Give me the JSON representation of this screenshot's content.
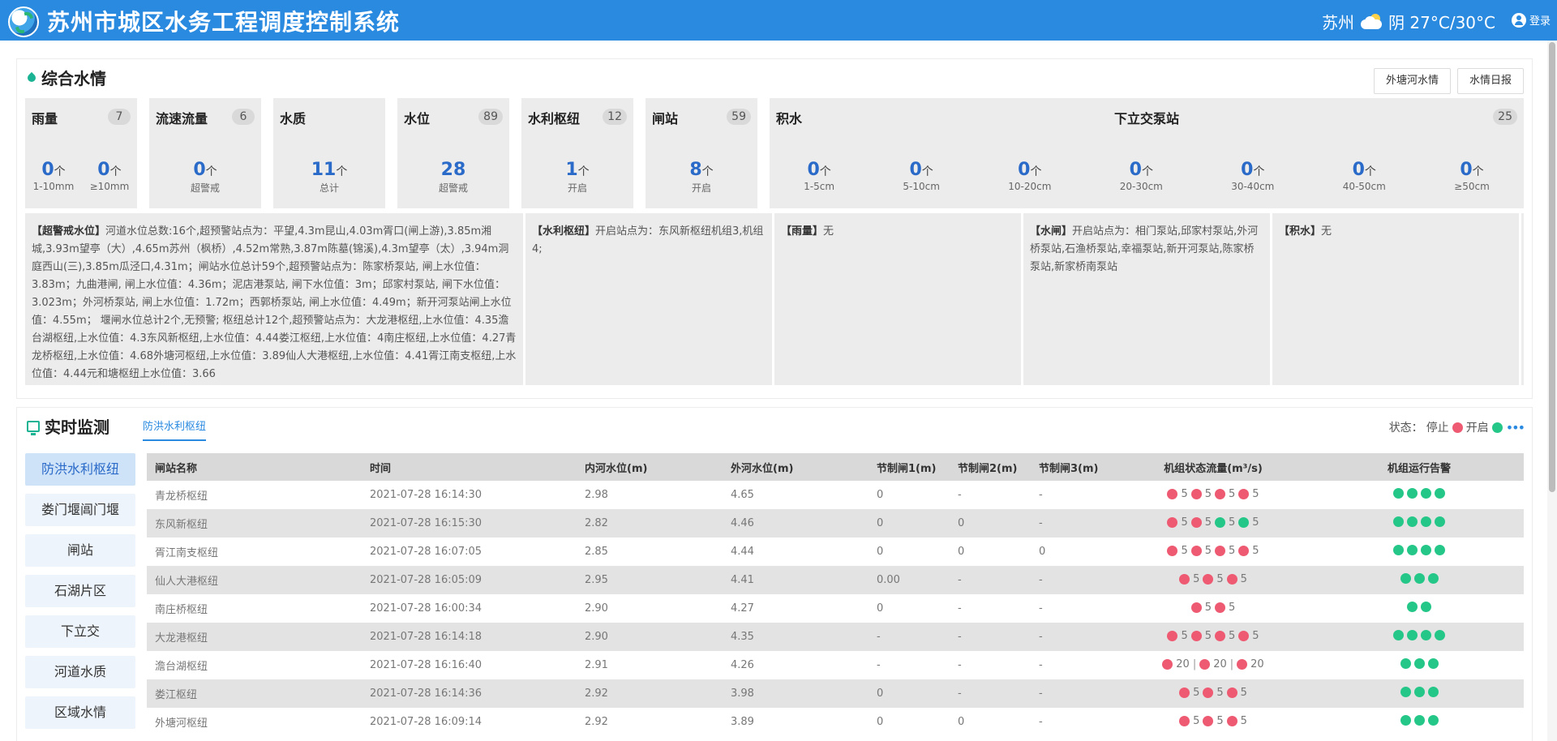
{
  "header": {
    "title": "苏州市城区水务工程调度控制系统",
    "city": "苏州",
    "weather_text": "阴 27°C/30°C",
    "login_label": "登录"
  },
  "overview": {
    "title": "综合水情",
    "buttons": [
      "外塘河水情",
      "水情日报"
    ],
    "cards": [
      {
        "label": "雨量",
        "count": "7",
        "metrics": [
          {
            "value": "0",
            "unit": "个",
            "caption": "1-10mm"
          },
          {
            "value": "0",
            "unit": "个",
            "caption": "≥10mm"
          }
        ]
      },
      {
        "label": "流速流量",
        "count": "6",
        "metrics": [
          {
            "value": "0",
            "unit": "个",
            "caption": "超警戒"
          }
        ]
      },
      {
        "label": "水质",
        "count": "",
        "metrics": [
          {
            "value": "11",
            "unit": "个",
            "caption": "总计"
          }
        ]
      },
      {
        "label": "水位",
        "count": "89",
        "metrics": [
          {
            "value": "28",
            "unit": "",
            "caption": "超警戒"
          }
        ]
      },
      {
        "label": "水利枢纽",
        "count": "12",
        "metrics": [
          {
            "value": "1",
            "unit": "个",
            "caption": "开启"
          }
        ]
      },
      {
        "label": "闸站",
        "count": "59",
        "metrics": [
          {
            "value": "8",
            "unit": "个",
            "caption": "开启"
          }
        ]
      }
    ],
    "wide_card": {
      "label": "积水",
      "sublabel": "下立交泵站",
      "count": "25",
      "metrics": [
        {
          "value": "0",
          "unit": "个",
          "caption": "1-5cm"
        },
        {
          "value": "0",
          "unit": "个",
          "caption": "5-10cm"
        },
        {
          "value": "0",
          "unit": "个",
          "caption": "10-20cm"
        },
        {
          "value": "0",
          "unit": "个",
          "caption": "20-30cm"
        },
        {
          "value": "0",
          "unit": "个",
          "caption": "30-40cm"
        },
        {
          "value": "0",
          "unit": "个",
          "caption": "40-50cm"
        },
        {
          "value": "0",
          "unit": "个",
          "caption": "≥50cm"
        }
      ]
    },
    "alerts": [
      {
        "tag": "【超警戒水位】",
        "text": "河道水位总数:16个,超预警站点为：平望,4.3m昆山,4.03m胥口(闸上游),3.85m湘城,3.93m望亭（大）,4.65m苏州（枫桥）,4.52m常熟,3.87m陈墓(锦溪),4.3m望亭（太）,3.94m洞庭西山(三),3.85m瓜泾口,4.31m；闸站水位总计59个,超预警站点为：陈家桥泵站, 闸上水位值：3.83m；九曲港闸, 闸上水位值：4.36m；泥店港泵站, 闸下水位值：3m；邱家村泵站, 闸下水位值：3.023m；外河桥泵站, 闸上水位值：1.72m；西郭桥泵站, 闸上水位值：4.49m；新开河泵站闸上水位值：4.55m； 堰闸水位总计2个,无预警; 枢纽总计12个,超预警站点为：大龙港枢纽,上水位值：4.35澹台湖枢纽,上水位值：4.3东风新枢纽,上水位值：4.44娄江枢纽,上水位值：4南庄枢纽,上水位值：4.27青龙桥枢纽,上水位值：4.68外塘河枢纽,上水位值：3.89仙人大港枢纽,上水位值：4.41胥江南支枢纽,上水位值：4.44元和塘枢纽上水位值：3.66"
      },
      {
        "tag": "【水利枢纽】",
        "text": "开启站点为：东风新枢纽机组3,机组4;"
      },
      {
        "tag": "【雨量】",
        "text": "无"
      },
      {
        "tag": "【水闸】",
        "text": "开启站点为：相门泵站,邱家村泵站,外河桥泵站,石渔桥泵站,幸福泵站,新开河泵站,陈家桥泵站,新家桥南泵站"
      },
      {
        "tag": "【积水】",
        "text": "无"
      }
    ]
  },
  "monitor": {
    "title": "实时监测",
    "active_tab": "防洪水利枢纽",
    "status_label": "状态：",
    "stop_label": "停止",
    "open_label": "开启",
    "menu": [
      "防洪水利枢纽",
      "娄门堰阊门堰",
      "闸站",
      "石湖片区",
      "下立交",
      "河道水质",
      "区域水情"
    ],
    "columns": [
      "闸站名称",
      "时间",
      "内河水位(m)",
      "外河水位(m)",
      "节制闸1(m)",
      "节制闸2(m)",
      "节制闸3(m)",
      "机组状态流量(m³/s)",
      "机组运行告警"
    ],
    "rows": [
      {
        "name": "青龙桥枢纽",
        "time": "2021-07-28 16:14:30",
        "inner": "2.98",
        "outer": "4.65",
        "g1": "0",
        "g2": "-",
        "g3": "-",
        "units": [
          [
            "red",
            "5"
          ],
          [
            "red",
            "5"
          ],
          [
            "red",
            "5"
          ],
          [
            "red",
            "5"
          ]
        ],
        "alarms": [
          "green",
          "green",
          "green",
          "green"
        ]
      },
      {
        "name": "东风新枢纽",
        "time": "2021-07-28 16:15:30",
        "inner": "2.82",
        "outer": "4.46",
        "g1": "0",
        "g2": "0",
        "g3": "-",
        "units": [
          [
            "red",
            "5"
          ],
          [
            "red",
            "5"
          ],
          [
            "green",
            "5"
          ],
          [
            "green",
            "5"
          ]
        ],
        "alarms": [
          "green",
          "green",
          "green",
          "green"
        ]
      },
      {
        "name": "胥江南支枢纽",
        "time": "2021-07-28 16:07:05",
        "inner": "2.85",
        "outer": "4.44",
        "g1": "0",
        "g2": "0",
        "g3": "0",
        "units": [
          [
            "red",
            "5"
          ],
          [
            "red",
            "5"
          ],
          [
            "red",
            "5"
          ],
          [
            "red",
            "5"
          ]
        ],
        "alarms": [
          "green",
          "green",
          "green",
          "green"
        ]
      },
      {
        "name": "仙人大港枢纽",
        "time": "2021-07-28 16:05:09",
        "inner": "2.95",
        "outer": "4.41",
        "g1": "0.00",
        "g2": "-",
        "g3": "-",
        "units": [
          [
            "red",
            "5"
          ],
          [
            "red",
            "5"
          ],
          [
            "red",
            "5"
          ]
        ],
        "alarms": [
          "green",
          "green",
          "green"
        ]
      },
      {
        "name": "南庄桥枢纽",
        "time": "2021-07-28 16:00:34",
        "inner": "2.90",
        "outer": "4.27",
        "g1": "0",
        "g2": "-",
        "g3": "-",
        "units": [
          [
            "red",
            "5"
          ],
          [
            "red",
            "5"
          ]
        ],
        "alarms": [
          "green",
          "green"
        ]
      },
      {
        "name": "大龙港枢纽",
        "time": "2021-07-28 16:14:18",
        "inner": "2.90",
        "outer": "4.35",
        "g1": "-",
        "g2": "-",
        "g3": "-",
        "units": [
          [
            "red",
            "5"
          ],
          [
            "red",
            "5"
          ],
          [
            "red",
            "5"
          ],
          [
            "red",
            "5"
          ]
        ],
        "alarms": [
          "green",
          "green",
          "green",
          "green"
        ]
      },
      {
        "name": "澹台湖枢纽",
        "time": "2021-07-28 16:16:40",
        "inner": "2.91",
        "outer": "4.26",
        "g1": "-",
        "g2": "-",
        "g3": "-",
        "units": [
          [
            "red",
            "20"
          ],
          [
            "red",
            "20"
          ],
          [
            "red",
            "20"
          ]
        ],
        "alarms": [
          "green",
          "green",
          "green"
        ]
      },
      {
        "name": "娄江枢纽",
        "time": "2021-07-28 16:14:36",
        "inner": "2.92",
        "outer": "3.98",
        "g1": "0",
        "g2": "-",
        "g3": "-",
        "units": [
          [
            "red",
            "5"
          ],
          [
            "red",
            "5"
          ],
          [
            "red",
            "5"
          ]
        ],
        "alarms": [
          "green",
          "green",
          "green"
        ]
      },
      {
        "name": "外塘河枢纽",
        "time": "2021-07-28 16:09:14",
        "inner": "2.92",
        "outer": "3.89",
        "g1": "0",
        "g2": "0",
        "g3": "-",
        "units": [
          [
            "red",
            "5"
          ],
          [
            "red",
            "5"
          ],
          [
            "red",
            "5"
          ]
        ],
        "alarms": [
          "green",
          "green",
          "green"
        ]
      }
    ]
  }
}
